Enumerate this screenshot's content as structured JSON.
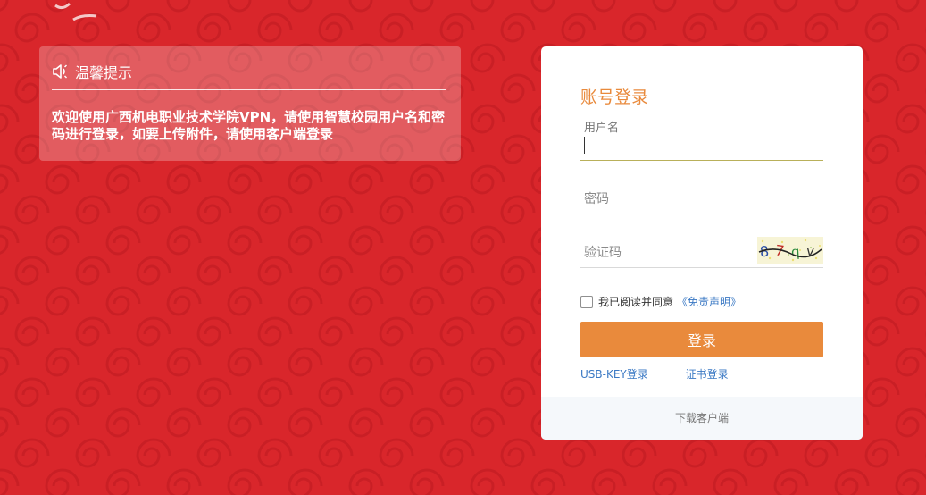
{
  "colors": {
    "background": "#d9262b",
    "accent": "#e98a3c",
    "link": "#3b79c4"
  },
  "notice": {
    "icon": "speaker-icon",
    "title": "温馨提示",
    "message": "欢迎使用广西机电职业技术学院VPN，请使用智慧校园用户名和密码进行登录，如要上传附件，请使用客户端登录"
  },
  "login": {
    "title": "账号登录",
    "username_label": "用户名",
    "username_value": "",
    "password_placeholder": "密码",
    "password_value": "",
    "captcha_placeholder": "验证码",
    "captcha_value": "",
    "captcha_image_text": "87qv",
    "agree_text": "我已阅读并同意",
    "agree_link": "《免责声明》",
    "agree_checked": false,
    "submit_label": "登录",
    "usbkey_link": "USB-KEY登录",
    "cert_link": "证书登录",
    "footer_link": "下载客户端"
  }
}
